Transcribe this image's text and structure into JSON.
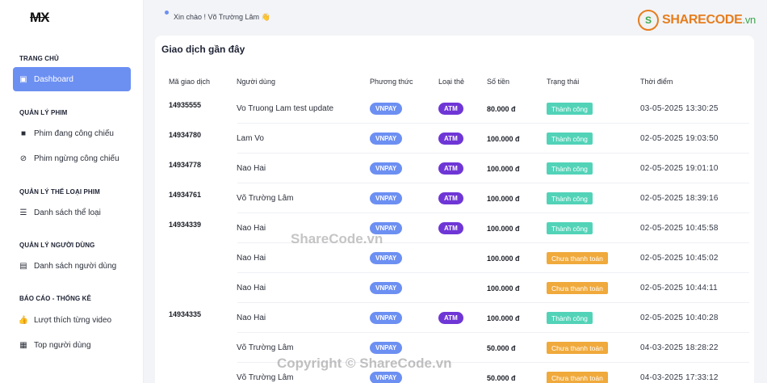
{
  "app": {
    "logo": "MX"
  },
  "header": {
    "greeting": "Xin chào ! Võ Trường Lâm 👋"
  },
  "brand": {
    "badge": "S",
    "name": "SHARECODE",
    "suffix": ".vn"
  },
  "sidebar": {
    "sections": [
      {
        "title": "TRANG CHỦ"
      },
      {
        "title": "QUẢN LÝ PHIM"
      },
      {
        "title": "QUẢN LÝ THỂ LOẠI PHIM"
      },
      {
        "title": "QUẢN LÝ NGƯỜI DÙNG"
      },
      {
        "title": "BÁO CÁO - THỐNG KÊ"
      }
    ],
    "items": [
      {
        "label": "Dashboard",
        "icon": "dashboard-icon",
        "active": true
      },
      {
        "label": "Phim đang công chiếu",
        "icon": "video-icon"
      },
      {
        "label": "Phim ngừng công chiếu",
        "icon": "ban-icon"
      },
      {
        "label": "Danh sách thể loại",
        "icon": "list-icon"
      },
      {
        "label": "Danh sách người dùng",
        "icon": "user-card-icon"
      },
      {
        "label": "Lượt thích từng video",
        "icon": "thumbs-up-icon"
      },
      {
        "label": "Top người dùng",
        "icon": "ticket-icon"
      }
    ]
  },
  "main": {
    "title": "Giao dịch gần đây",
    "columns": [
      "Mã giao dịch",
      "Người dùng",
      "Phương thức",
      "Loại thẻ",
      "Số tiền",
      "Trạng thái",
      "Thời điểm"
    ],
    "rows": [
      {
        "id": "14935555",
        "user": "Vo Truong Lam test update",
        "method": "VNPAY",
        "card": "ATM",
        "amount": "80.000 đ",
        "status": "Thành công",
        "time": "03-05-2025 13:30:25"
      },
      {
        "id": "14934780",
        "user": "Lam Vo",
        "method": "VNPAY",
        "card": "ATM",
        "amount": "100.000 đ",
        "status": "Thành công",
        "time": "02-05-2025 19:03:50"
      },
      {
        "id": "14934778",
        "user": "Nao Hai",
        "method": "VNPAY",
        "card": "ATM",
        "amount": "100.000 đ",
        "status": "Thành công",
        "time": "02-05-2025 19:01:10"
      },
      {
        "id": "14934761",
        "user": "Võ Trường Lâm",
        "method": "VNPAY",
        "card": "ATM",
        "amount": "100.000 đ",
        "status": "Thành công",
        "time": "02-05-2025 18:39:16"
      },
      {
        "id": "14934339",
        "user": "Nao Hai",
        "method": "VNPAY",
        "card": "ATM",
        "amount": "100.000 đ",
        "status": "Thành công",
        "time": "02-05-2025 10:45:58"
      },
      {
        "id": "",
        "user": "Nao Hai",
        "method": "VNPAY",
        "card": "",
        "amount": "100.000 đ",
        "status": "Chưa thanh toán",
        "time": "02-05-2025 10:45:02"
      },
      {
        "id": "",
        "user": "Nao Hai",
        "method": "VNPAY",
        "card": "",
        "amount": "100.000 đ",
        "status": "Chưa thanh toán",
        "time": "02-05-2025 10:44:11"
      },
      {
        "id": "14934335",
        "user": "Nao Hai",
        "method": "VNPAY",
        "card": "ATM",
        "amount": "100.000 đ",
        "status": "Thành công",
        "time": "02-05-2025 10:40:28"
      },
      {
        "id": "",
        "user": "Võ Trường Lâm",
        "method": "VNPAY",
        "card": "",
        "amount": "50.000 đ",
        "status": "Chưa thanh toán",
        "time": "04-03-2025 18:28:22"
      },
      {
        "id": "",
        "user": "Võ Trường Lâm",
        "method": "VNPAY",
        "card": "",
        "amount": "50.000 đ",
        "status": "Chưa thanh toán",
        "time": "04-03-2025 17:33:12"
      }
    ]
  },
  "watermarks": {
    "center": "ShareCode.vn",
    "footer": "Copyright © ShareCode.vn"
  },
  "colors": {
    "accent": "#6c8ff2",
    "atm": "#6f36d6",
    "success": "#52d3b8",
    "pending": "#f0a93b"
  }
}
